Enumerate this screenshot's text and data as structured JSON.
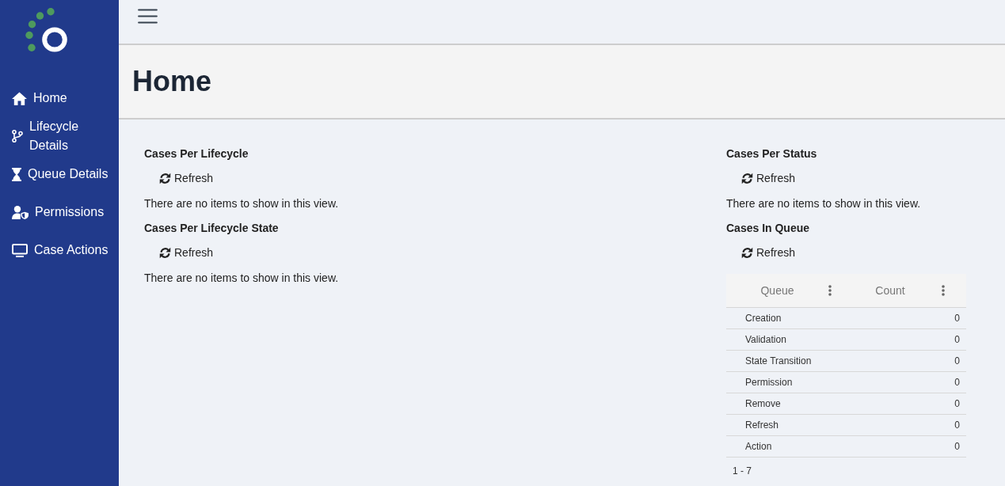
{
  "sidebar": {
    "items": [
      {
        "label": "Home",
        "kind": "home"
      },
      {
        "label": "Lifecycle Details",
        "kind": "branch"
      },
      {
        "label": "Queue Details",
        "kind": "hourglass"
      },
      {
        "label": "Permissions",
        "kind": "user-shield"
      },
      {
        "label": "Case Actions",
        "kind": "monitor"
      }
    ]
  },
  "page": {
    "title": "Home"
  },
  "columns": [
    {
      "panels": [
        {
          "kind": "message",
          "title": "Cases Per Lifecycle",
          "refresh_label": "Refresh",
          "message": "There are no items to show in this view."
        },
        {
          "kind": "message",
          "title": "Cases Per Lifecycle State",
          "refresh_label": "Refresh",
          "message": "There are no items to show in this view."
        }
      ]
    },
    {
      "panels": [
        {
          "kind": "message",
          "title": "Cases Per Status",
          "refresh_label": "Refresh",
          "message": "There are no items to show in this view."
        },
        {
          "kind": "table",
          "title": "Cases In Queue",
          "refresh_label": "Refresh",
          "table": {
            "columns": [
              "Queue",
              "Count"
            ],
            "rows": [
              [
                "Creation",
                "0"
              ],
              [
                "Validation",
                "0"
              ],
              [
                "State Transition",
                "0"
              ],
              [
                "Permission",
                "0"
              ],
              [
                "Remove",
                "0"
              ],
              [
                "Refresh",
                "0"
              ],
              [
                "Action",
                "0"
              ]
            ],
            "footer": "1 - 7"
          }
        }
      ]
    }
  ]
}
